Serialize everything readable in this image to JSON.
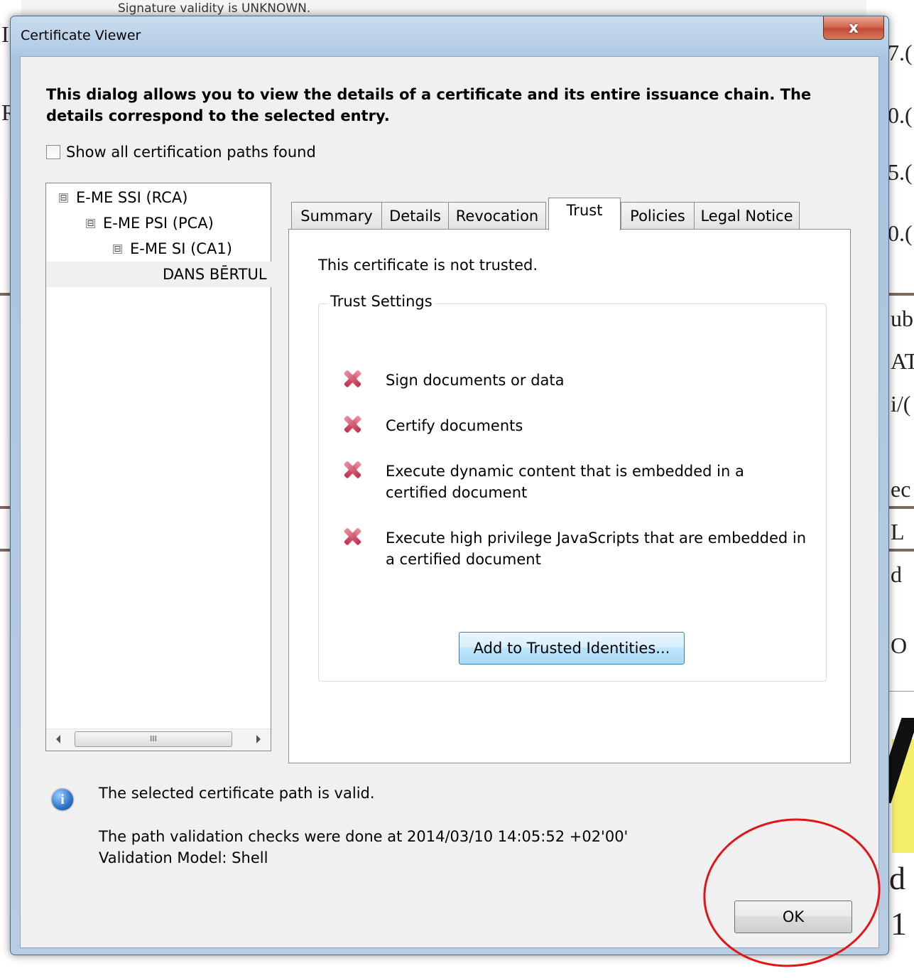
{
  "background": {
    "top_text": "Signature validity is UNKNOWN.",
    "edge_glyphs": [
      "I",
      "R",
      "7.(",
      "0.(",
      "5.(",
      "0.(",
      "ub",
      "AT",
      "i/(",
      "ec",
      "L",
      "d",
      "O",
      "d",
      "1"
    ]
  },
  "window": {
    "title": "Certificate Viewer",
    "close_symbol": "x"
  },
  "intro_text": "This dialog allows you to view the details of a certificate and its entire issuance chain. The details correspond to the selected entry.",
  "show_all_paths": {
    "label": "Show all certification paths found",
    "checked": false
  },
  "tree": {
    "nodes": [
      {
        "label": "E-ME SSI (RCA)",
        "expander": "⊟"
      },
      {
        "label": "E-ME PSI (PCA)",
        "expander": "⊟"
      },
      {
        "label": "E-ME SI (CA1)",
        "expander": "⊟"
      },
      {
        "label": "DANS BĒRTUL",
        "expander": ""
      }
    ],
    "scrollbar_grip": "III"
  },
  "tabs": [
    "Summary",
    "Details",
    "Revocation",
    "Trust",
    "Policies",
    "Legal Notice"
  ],
  "active_tab": "Trust",
  "trust": {
    "status_text": "This certificate is not trusted.",
    "group_title": "Trust Settings",
    "permissions": [
      {
        "text": "Sign documents or data",
        "icon": "x-mark-icon",
        "allowed": false
      },
      {
        "text": "Certify documents",
        "icon": "x-mark-icon",
        "allowed": false
      },
      {
        "text": "Execute dynamic content that is embedded in a certified document",
        "icon": "x-mark-icon",
        "allowed": false
      },
      {
        "text": "Execute high privilege JavaScripts that are embedded in a certified document",
        "icon": "x-mark-icon",
        "allowed": false
      }
    ],
    "add_button": "Add to Trusted Identities..."
  },
  "footer": {
    "info_icon": "info-icon",
    "path_valid_text": "The selected certificate path is valid.",
    "checks_text": "The path validation checks were done at 2014/03/10 14:05:52 +02'00'",
    "validation_model": "Validation Model: Shell",
    "ok_button": "OK"
  },
  "colors": {
    "annotation_circle": "#e01515",
    "x_mark": "#c0304e",
    "close_button": "#c44a36"
  }
}
